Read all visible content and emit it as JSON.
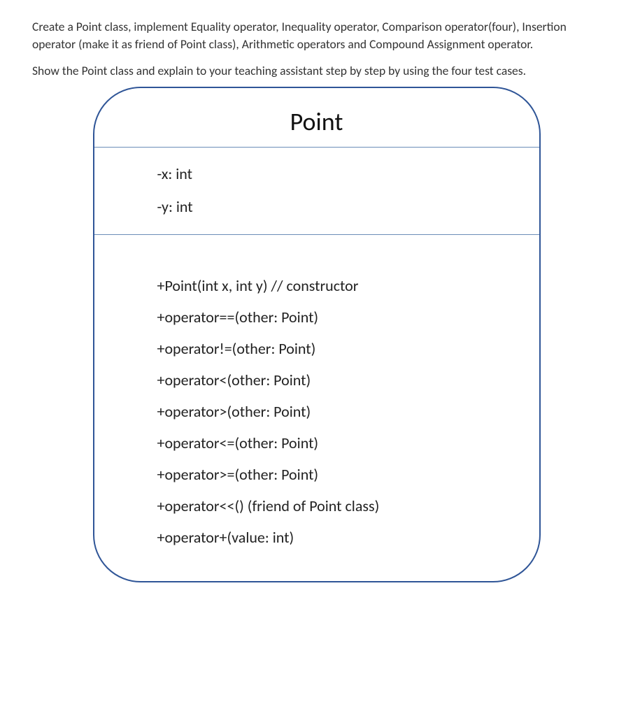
{
  "intro": {
    "p1": "Create a Point class, implement Equality operator, Inequality operator, Comparison operator(four), Insertion operator (make it as friend of Point class), Arithmetic operators and Compound Assignment operator.",
    "p2": "Show the Point class and explain to your teaching assistant step by step by using the four test cases."
  },
  "uml": {
    "title": "Point",
    "attributes": [
      "-x: int",
      "-y: int"
    ],
    "methods": [
      "+Point(int x, int y) // constructor",
      "+operator==(other: Point)",
      "+operator!=(other: Point)",
      "+operator<(other: Point)",
      "+operator>(other: Point)",
      "+operator<=(other: Point)",
      "+operator>=(other: Point)",
      "+operator<<() (friend of Point class)",
      "+operator+(value: int)"
    ]
  }
}
